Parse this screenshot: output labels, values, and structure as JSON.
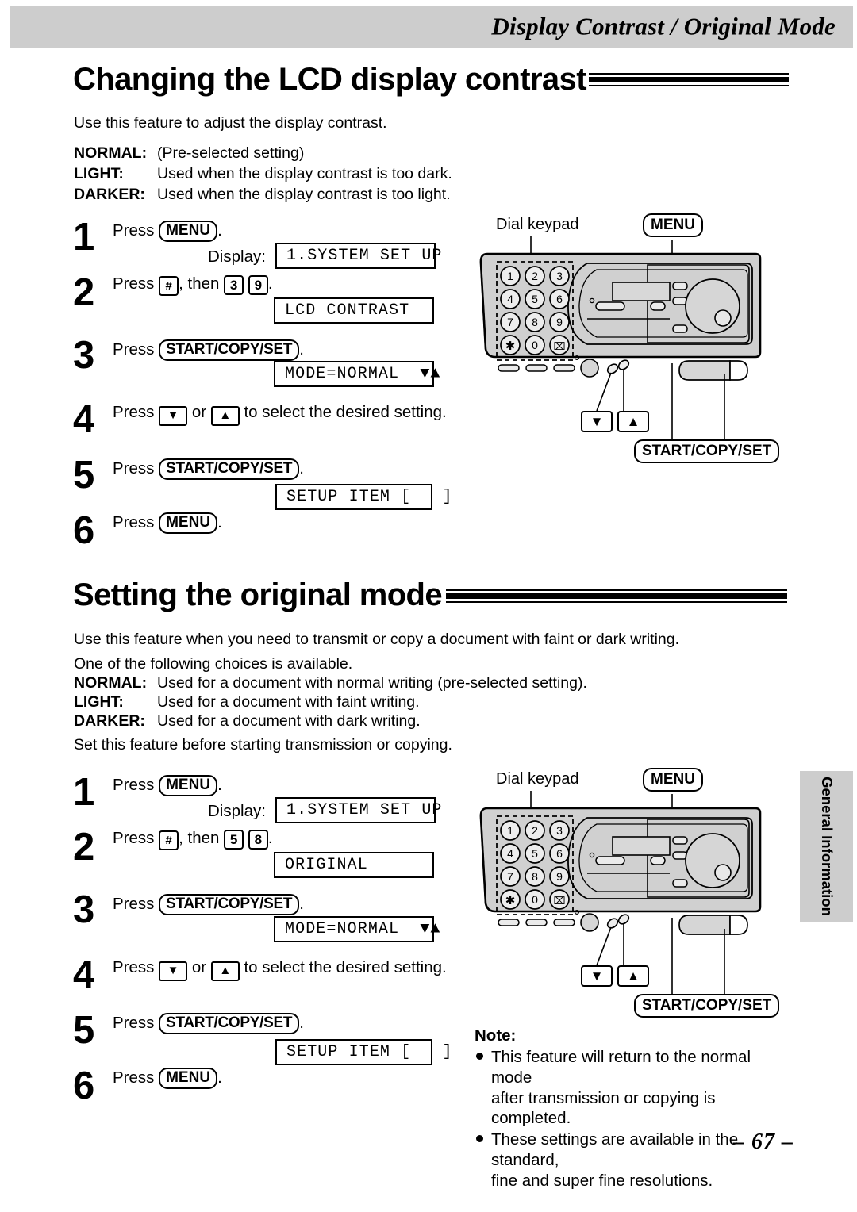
{
  "header": {
    "title": "Display Contrast  / Original Mode"
  },
  "sections": [
    {
      "heading": "Changing the LCD display contrast",
      "intro": "Use this feature to adjust the display contrast.",
      "definitions": [
        {
          "term": "NORMAL:",
          "desc": "(Pre-selected setting)"
        },
        {
          "term": "LIGHT:",
          "desc": "Used when the display contrast is too dark."
        },
        {
          "term": "DARKER:",
          "desc": "Used when the display contrast is too light."
        }
      ],
      "steps": [
        {
          "num": "1",
          "press": "Press",
          "key": "MENU",
          "tail": ".",
          "display_label": "Display:",
          "lcd": "1.SYSTEM SET UP"
        },
        {
          "num": "2",
          "press": "Press",
          "hash": "#",
          "then": ", then",
          "d1": "3",
          "d2": "9",
          "tail": ".",
          "lcd": "LCD CONTRAST"
        },
        {
          "num": "3",
          "press": "Press",
          "key": "START/COPY/SET",
          "tail": ".",
          "lcd": "MODE=NORMAL  ▼▲"
        },
        {
          "num": "4",
          "press": "Press",
          "down": "▼",
          "or": "or",
          "up": "▲",
          "tail2": "to select the desired setting."
        },
        {
          "num": "5",
          "press": "Press",
          "key": "START/COPY/SET",
          "tail": ".",
          "lcd": "SETUP ITEM [   ]"
        },
        {
          "num": "6",
          "press": "Press",
          "key": "MENU",
          "tail": "."
        }
      ]
    },
    {
      "heading": "Setting the original mode",
      "intro": "Use this feature when you need to transmit or copy a document with faint or dark writing.",
      "intro2": "One of the following choices is available.",
      "definitions": [
        {
          "term": "NORMAL:",
          "desc": "Used for a document with normal writing (pre-selected setting)."
        },
        {
          "term": "LIGHT:",
          "desc": "Used for a document with faint writing."
        },
        {
          "term": "DARKER:",
          "desc": "Used for a document with dark writing."
        }
      ],
      "outro": "Set this feature before starting transmission or copying.",
      "steps": [
        {
          "num": "1",
          "press": "Press",
          "key": "MENU",
          "tail": ".",
          "display_label": "Display:",
          "lcd": "1.SYSTEM SET UP"
        },
        {
          "num": "2",
          "press": "Press",
          "hash": "#",
          "then": ", then",
          "d1": "5",
          "d2": "8",
          "tail": ".",
          "lcd": "ORIGINAL"
        },
        {
          "num": "3",
          "press": "Press",
          "key": "START/COPY/SET",
          "tail": ".",
          "lcd": "MODE=NORMAL  ▼▲"
        },
        {
          "num": "4",
          "press": "Press",
          "down": "▼",
          "or": "or",
          "up": "▲",
          "tail2": "to select the desired setting."
        },
        {
          "num": "5",
          "press": "Press",
          "key": "START/COPY/SET",
          "tail": ".",
          "lcd": "SETUP ITEM [   ]"
        },
        {
          "num": "6",
          "press": "Press",
          "key": "MENU",
          "tail": "."
        }
      ]
    }
  ],
  "illustration": {
    "dial_keypad_label": "Dial keypad",
    "menu_callout": "MENU",
    "start_callout": "START/COPY/SET",
    "keypad": [
      "1",
      "2",
      "3",
      "4",
      "5",
      "6",
      "7",
      "8",
      "9",
      "✳",
      "0",
      "⌗"
    ],
    "down_key": "▼",
    "up_key": "▲"
  },
  "side_tab": {
    "label": "General Information"
  },
  "note": {
    "title": "Note:",
    "items": [
      {
        "l1": "This feature will return to the normal mode",
        "l2": "after transmission or copying is completed."
      },
      {
        "l1": "These settings are available in the standard,",
        "l2": "fine and super fine resolutions."
      }
    ]
  },
  "page_number": "– 67 –",
  "colors": {
    "band_gray": "#cdcdcd",
    "machine_body": "#d0d0d0",
    "ink": "#000000"
  }
}
